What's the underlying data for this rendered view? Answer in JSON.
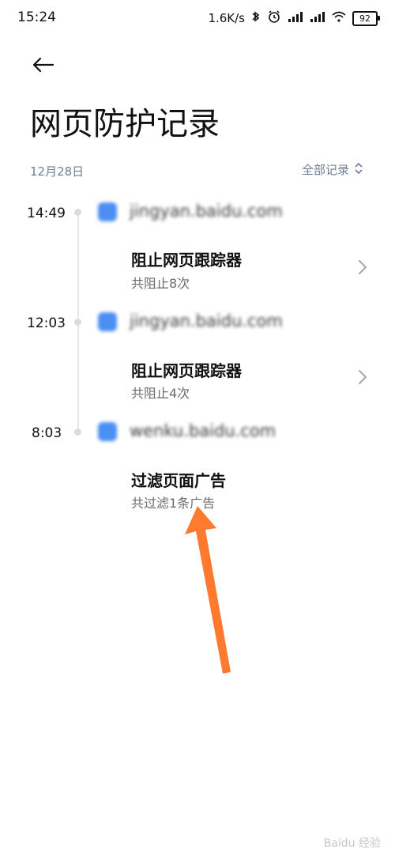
{
  "status_bar": {
    "time": "15:24",
    "speed": "1.6K/s",
    "battery": "92"
  },
  "header": {
    "title": "网页防护记录"
  },
  "date_label": "12月28日",
  "filter": {
    "label": "全部记录"
  },
  "records": [
    {
      "time": "14:49",
      "site": "jingyan.baidu.com",
      "title": "阻止网页跟踪器",
      "subtitle": "共阻止8次",
      "has_chevron": true
    },
    {
      "time": "12:03",
      "site": "jingyan.baidu.com",
      "title": "阻止网页跟踪器",
      "subtitle": "共阻止4次",
      "has_chevron": true
    },
    {
      "time": "8:03",
      "site": "wenku.baidu.com",
      "title": "过滤页面广告",
      "subtitle": "共过滤1条广告",
      "has_chevron": false
    }
  ],
  "watermark": "Baidu 经验",
  "colors": {
    "text_primary": "#111111",
    "text_secondary": "#6b6b6b",
    "accent_gray": "#6f7d94",
    "arrow": "#ff7a2f"
  }
}
